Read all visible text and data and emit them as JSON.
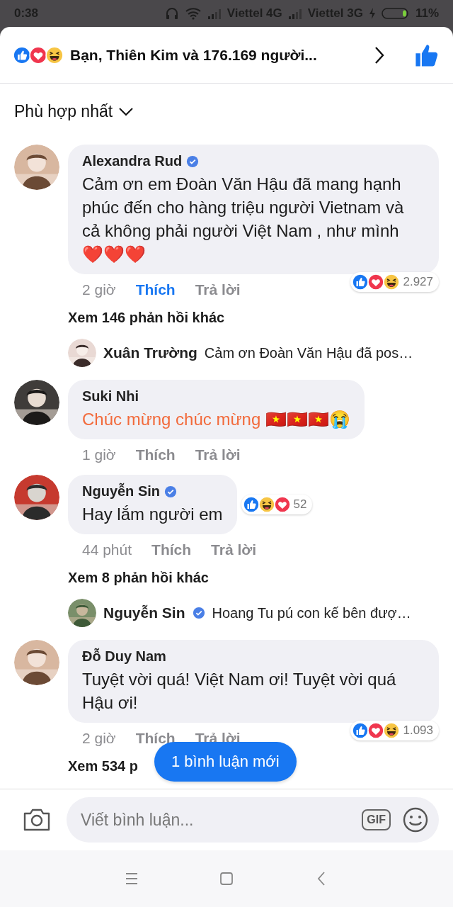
{
  "status_bar": {
    "time": "0:38",
    "carriers": [
      "Viettel 4G",
      "Viettel 3G"
    ],
    "battery": "11%"
  },
  "header": {
    "reactions": [
      {
        "kind": "like"
      },
      {
        "kind": "love"
      },
      {
        "kind": "haha"
      }
    ],
    "title": "Bạn, Thiên Kim và 176.169 người..."
  },
  "sort": {
    "label": "Phù hợp nhất"
  },
  "comments": [
    {
      "author": "Alexandra Rud",
      "verified": true,
      "text": "Cảm ơn em Đoàn Văn Hậu đã mang hạnh phúc đến cho hàng triệu người Vietnam và cả không phải người Việt Nam , như mình ❤️❤️❤️",
      "highlighted": false,
      "time": "2 giờ",
      "like": "Thích",
      "liked": true,
      "reply": "Trả lời",
      "reactions": [
        {
          "kind": "like"
        },
        {
          "kind": "love"
        },
        {
          "kind": "haha"
        }
      ],
      "reaction_count": "2.927",
      "reactions_beside": false,
      "more_replies": "Xem 146 phản hồi khác",
      "reply_preview": {
        "author": "Xuân Trường",
        "verified": false,
        "text": "Cảm ơn Đoàn Văn Hậu đã pos…"
      }
    },
    {
      "author": "Suki Nhi",
      "verified": false,
      "text": "Chúc mừng chúc mừng 🇻🇳🇻🇳🇻🇳😭",
      "highlighted": true,
      "time": "1 giờ",
      "like": "Thích",
      "liked": false,
      "reply": "Trả lời"
    },
    {
      "author": "Nguyễn Sin",
      "verified": true,
      "text": "Hay lắm người em",
      "highlighted": false,
      "time": "44 phút",
      "like": "Thích",
      "liked": false,
      "reply": "Trả lời",
      "reactions": [
        {
          "kind": "like"
        },
        {
          "kind": "haha"
        },
        {
          "kind": "love"
        }
      ],
      "reaction_count": "52",
      "reactions_beside": true,
      "more_replies": "Xem 8 phản hồi khác",
      "reply_preview": {
        "author": "Nguyễn Sin",
        "verified": true,
        "text": "Hoang Tu pú con kế bên đượ…"
      }
    },
    {
      "author": "Đỗ Duy Nam",
      "verified": false,
      "text": "Tuyệt vời quá! Việt Nam ơi! Tuyệt vời quá Hậu ơi!",
      "highlighted": false,
      "time": "2 giờ",
      "like": "Thích",
      "liked": false,
      "reply": "Trả lời",
      "reactions": [
        {
          "kind": "like"
        },
        {
          "kind": "love"
        },
        {
          "kind": "haha"
        }
      ],
      "reaction_count": "1.093",
      "reactions_beside": false,
      "more_replies": "Xem 534 p"
    }
  ],
  "new_comments_button": "1 bình luận mới",
  "composer": {
    "placeholder": "Viết bình luận...",
    "gif": "GIF"
  }
}
